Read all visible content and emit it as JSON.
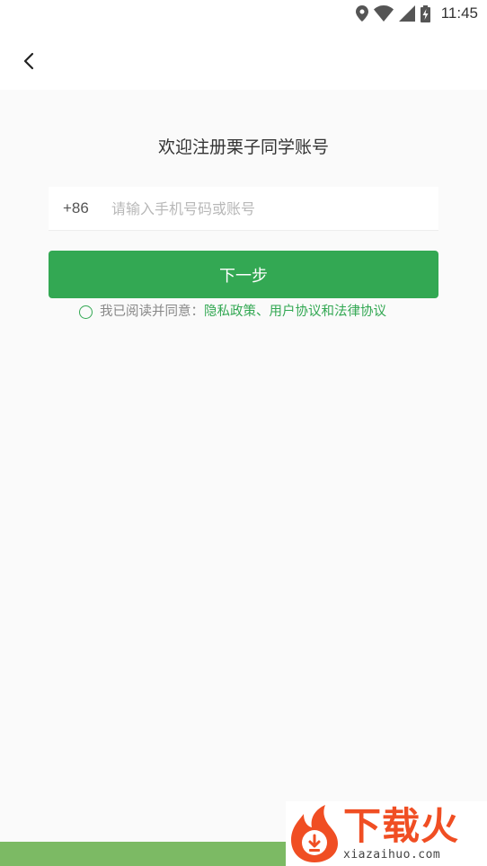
{
  "status_bar": {
    "time": "11:45",
    "icons": [
      "location-icon",
      "wifi-icon",
      "signal-icon",
      "battery-charging-icon"
    ]
  },
  "app_bar": {
    "back_icon": "chevron-left-icon"
  },
  "register": {
    "title": "欢迎注册栗子同学账号",
    "country_code": "+86",
    "phone_placeholder": "请输入手机号码或账号",
    "next_label": "下一步",
    "agreement_prefix": "我已阅读并同意：",
    "agreement_links": "隐私政策、用户协议和法律协议"
  },
  "watermark": {
    "title": "下载火",
    "url": "xiazaihuo.com"
  },
  "colors": {
    "accent": "#33a853",
    "background": "#fafafa",
    "watermark": "#f04e23",
    "bottom_stripe": "#7cba64"
  }
}
